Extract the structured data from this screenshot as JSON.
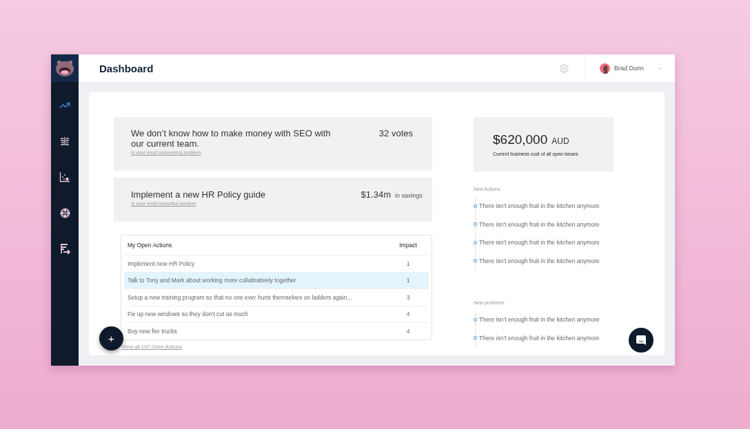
{
  "sidebar": {
    "items": [
      {
        "kind": "trend",
        "selected": true
      },
      {
        "kind": "list",
        "selected": false
      },
      {
        "kind": "scatter",
        "selected": false
      },
      {
        "kind": "ball",
        "selected": false
      },
      {
        "kind": "route",
        "selected": false
      }
    ]
  },
  "header": {
    "title": "Dashboard",
    "user": {
      "name": "Brad Dunn"
    }
  },
  "highlights": [
    {
      "text": "We don’t know how to make money with SEO with our current team.",
      "caption": "Is your most concerning problem",
      "figure": "32 votes"
    },
    {
      "text": "Implement a new HR Policy guide",
      "caption": "Is your most impactful solution",
      "figure": "$1.34m",
      "figure_unit": "in savings"
    }
  ],
  "open_actions": {
    "columns": [
      "My Open Actions",
      "Impact"
    ],
    "rows": [
      {
        "action": "Implement new HR Policy",
        "impact": "1",
        "selected": false
      },
      {
        "action": "Talk to Tony and Mark about working more collabratively together",
        "impact": "1",
        "selected": true
      },
      {
        "action": "Setup a new training program so that no one ever hurts themselves on ladders again...",
        "impact": "3",
        "selected": false
      },
      {
        "action": "Fix up new windows so they don’t cut as much",
        "impact": "4",
        "selected": false
      },
      {
        "action": "Buy new fire trucks",
        "impact": "4",
        "selected": false
      }
    ],
    "footer_link": "View all 192 Open Actions"
  },
  "fab": "+",
  "cost": {
    "amount": "$620,000",
    "currency": "AUD",
    "caption": "Current business cost of all open issues"
  },
  "feeds": [
    {
      "title": "New Actions",
      "items": [
        "There isn’t enough fruit in the kitchen anymore",
        "There isn’t enough fruit in the kitchen anymore",
        "There isn’t enough fruit in the kitchen anymore",
        "There isn’t enough fruit in the kitchen anymore"
      ]
    },
    {
      "title": "New problems",
      "items": [
        "There isn’t enough fruit in the kitchen anymore",
        "There isn’t enough fruit in the kitchen anymore"
      ]
    }
  ]
}
